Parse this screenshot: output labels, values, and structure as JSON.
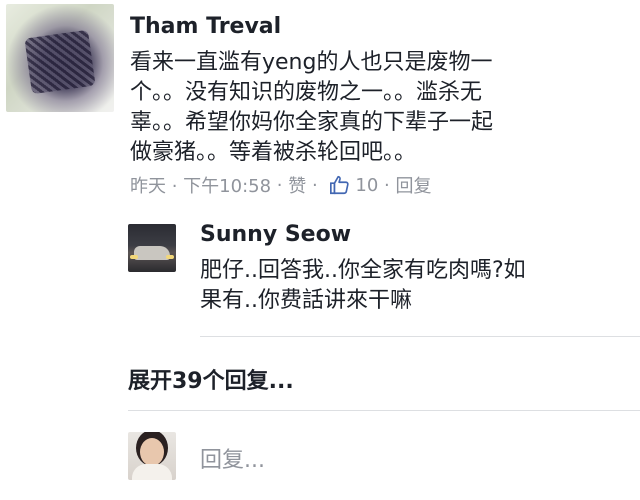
{
  "comment": {
    "author": "Tham Treval",
    "lines": [
      "看来一直滥有yeng的人也只是废物一",
      "个。。没有知识的废物之一。。滥杀无",
      "辜。。希望你妈你全家真的下辈子一起",
      "做豪猪。。等着被杀轮回吧。。"
    ],
    "meta": {
      "time": "昨天 · 下午10:58",
      "sep1": " · ",
      "like_label": "赞",
      "sep2": " · ",
      "like_count": "10",
      "sep3": " · ",
      "reply_label": "回复"
    }
  },
  "reply": {
    "author": "Sunny Seow",
    "lines": [
      "肥仔..回答我..你全家有吃肉嗎?如",
      "果有..你费話讲來干嘛"
    ]
  },
  "expand_label": "展开39个回复...",
  "reply_input": {
    "placeholder": "回复..."
  },
  "colors": {
    "text": "#1d2129",
    "meta": "#90949c",
    "like_blue": "#4267b2",
    "divider": "#dddfe2"
  },
  "icons": {
    "like": "thumbs-up-icon"
  }
}
